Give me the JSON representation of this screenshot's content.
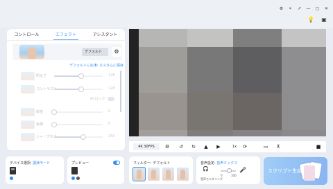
{
  "window": {
    "controls": [
      "⚙",
      "⌖",
      "↗",
      "—",
      "▢",
      "✕"
    ]
  },
  "header_icons": [
    "lightbulb-icon",
    "screen-icon"
  ],
  "left_panel": {
    "tabs": [
      {
        "label": "コントロール",
        "active": false
      },
      {
        "label": "エフェクト",
        "active": true
      },
      {
        "label": "アシスタント",
        "active": false
      }
    ],
    "preset": {
      "value": "デフォルト"
    },
    "actions": {
      "reset": "デフォルトに戻す",
      "save": "カスタムに保存"
    },
    "sliders": [
      {
        "label": "明るさ",
        "value": "128",
        "pct": 0.55
      },
      {
        "label": "コントラスト",
        "value": "128",
        "pct": 0.55
      },
      {
        "label": "彩度",
        "value": "0",
        "pct": 0.0
      },
      {
        "label": "色相",
        "value": "0",
        "pct": 0.0
      },
      {
        "label": "シャープネス",
        "value": "150",
        "pct": 0.6
      }
    ],
    "toggle_label": "AI  ロック"
  },
  "video": {
    "tile_colors": [
      [
        "#232323",
        "#b6b6b5",
        "#c3c3c2",
        "#7f7f80",
        "#c4c4c4"
      ],
      [
        "#232323",
        "#9e9d99",
        "#797878",
        "#5e5d5f",
        "#8e8e90"
      ],
      [
        "#232323",
        "#9a9490",
        "#797570",
        "#6b6564",
        "#8e8e91"
      ],
      [
        "#232323",
        "#a39e9b",
        "#817b7b",
        "#858184",
        "#8b898c"
      ]
    ]
  },
  "controls": {
    "resolution": "4K 30FPS",
    "zoom": "1x"
  },
  "bottom": {
    "device": {
      "label": "デバイス選択:",
      "mode": "講演モード"
    },
    "preview": {
      "label": "プレビュー"
    },
    "filter": {
      "label": "フィルター:",
      "value": "デフォルト"
    },
    "audio": {
      "label": "音声設定:",
      "value": "音声ミックス",
      "monitor": "音声モニタリング",
      "min": "0",
      "max": "100",
      "level": 0.6
    },
    "script_button": "スクリプト生成"
  },
  "colors": {
    "accent": "#3a8df0",
    "panel": "#ffffff",
    "bg": "#e9edf3"
  }
}
